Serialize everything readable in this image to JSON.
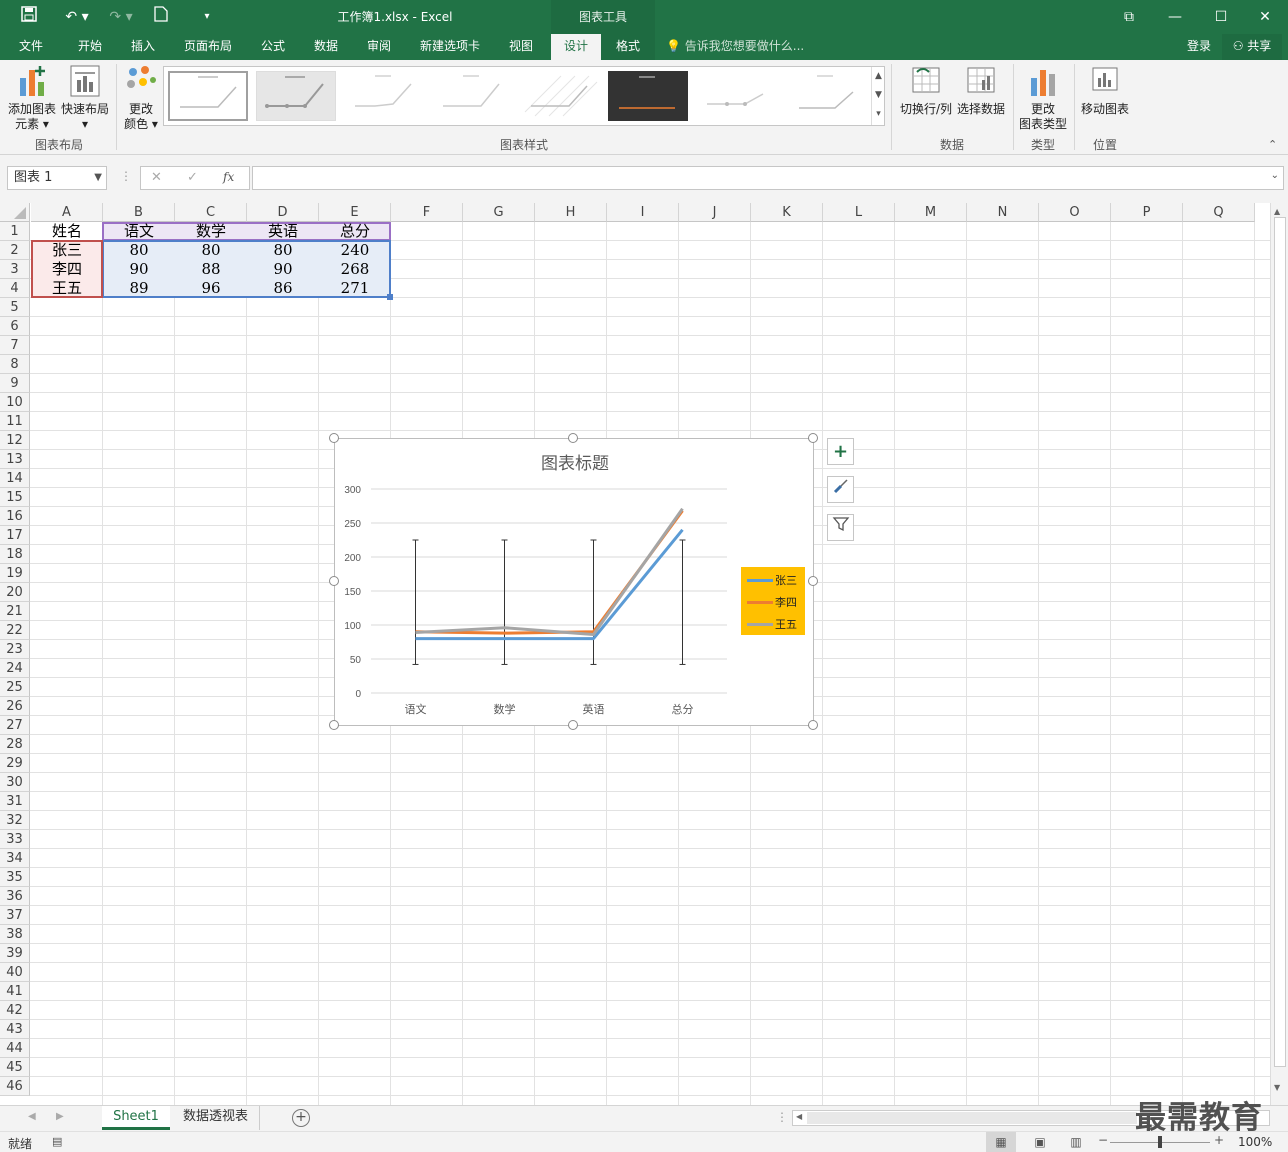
{
  "window": {
    "title": "工作簿1.xlsx - Excel",
    "context_tool": "图表工具",
    "minimize": "—",
    "maximize": "☐",
    "close": "✕",
    "restore": "⧉",
    "login": "登录",
    "share": "共享"
  },
  "tabs": [
    "文件",
    "开始",
    "插入",
    "页面布局",
    "公式",
    "数据",
    "审阅",
    "新建选项卡",
    "视图",
    "设计",
    "格式"
  ],
  "active_tab": "设计",
  "tell_me": "告诉我您想要做什么...",
  "ribbon": {
    "add_chart_element": [
      "添加图表",
      "元素 ▾"
    ],
    "quick_layout": [
      "快速布局",
      "▾"
    ],
    "change_colors": [
      "更改",
      "颜色 ▾"
    ],
    "switch_row_col": "切换行/列",
    "select_data": "选择数据",
    "change_chart_type": [
      "更改",
      "图表类型"
    ],
    "move_chart": "移动图表",
    "groups": {
      "chart_layout": "图表布局",
      "chart_styles": "图表样式",
      "data": "数据",
      "type": "类型",
      "location": "位置"
    }
  },
  "formula": {
    "name_box": "图表 1",
    "fx": "fx",
    "cancel": "✕",
    "enter": "✓",
    "value": ""
  },
  "columns": [
    "A",
    "B",
    "C",
    "D",
    "E",
    "F",
    "G",
    "H",
    "I",
    "J",
    "K",
    "L",
    "M",
    "N",
    "O",
    "P",
    "Q"
  ],
  "rows": [
    "1",
    "2",
    "3",
    "4",
    "5",
    "6",
    "7",
    "8",
    "9",
    "10",
    "11",
    "12",
    "13",
    "14",
    "15",
    "16",
    "17",
    "18",
    "19",
    "20",
    "21",
    "22",
    "23",
    "24",
    "25",
    "26",
    "27",
    "28",
    "29",
    "30",
    "31",
    "32",
    "33",
    "34",
    "35",
    "36",
    "37",
    "38",
    "39",
    "40",
    "41",
    "42",
    "43",
    "44",
    "45",
    "46"
  ],
  "table": {
    "header": [
      "姓名",
      "语文",
      "数学",
      "英语",
      "总分"
    ],
    "rows": [
      [
        "张三",
        "80",
        "80",
        "80",
        "240"
      ],
      [
        "李四",
        "90",
        "88",
        "90",
        "268"
      ],
      [
        "王五",
        "89",
        "96",
        "86",
        "271"
      ]
    ]
  },
  "chart_data": {
    "type": "line",
    "title": "图表标题",
    "categories": [
      "语文",
      "数学",
      "英语",
      "总分"
    ],
    "series": [
      {
        "name": "张三",
        "values": [
          80,
          80,
          80,
          240
        ],
        "color": "#5b9bd5"
      },
      {
        "name": "李四",
        "values": [
          90,
          88,
          90,
          268
        ],
        "color": "#ed7d31"
      },
      {
        "name": "王五",
        "values": [
          89,
          96,
          86,
          271
        ],
        "color": "#a5a5a5"
      }
    ],
    "error_bars": {
      "low": 42,
      "high": 225
    },
    "yticks": [
      "0",
      "50",
      "100",
      "150",
      "200",
      "250",
      "300"
    ],
    "ylim": [
      0,
      300
    ],
    "grid": true,
    "legend_position": "right",
    "legend_background": "#ffc000"
  },
  "sheets": [
    "Sheet1",
    "数据透视表"
  ],
  "active_sheet": "Sheet1",
  "status": {
    "ready": "就绪",
    "zoom": "100%"
  },
  "colors": {
    "excel_green": "#217346",
    "accent": "#217346"
  },
  "watermark": "最需教育"
}
